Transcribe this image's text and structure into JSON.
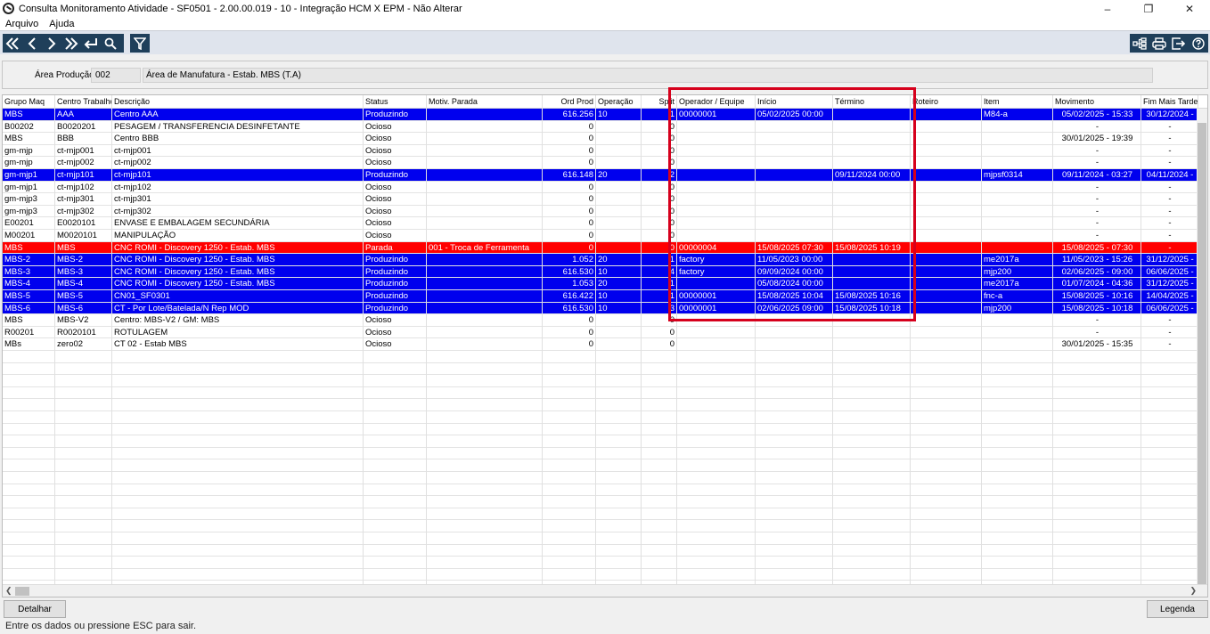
{
  "window": {
    "title": "Consulta Monitoramento Atividade - SF0501 - 2.00.00.019 - 10 - Integração HCM X EPM - Não Alterar",
    "minimize": "–",
    "maximize": "❐",
    "close": "✕"
  },
  "menu": [
    "Arquivo",
    "Ajuda"
  ],
  "header": {
    "area_label": "Área Produção:",
    "area_code": "002",
    "area_desc": "Área de Manufatura - Estab. MBS (T.A)"
  },
  "columns": [
    "Grupo Maq",
    "Centro Trabalho",
    "Descrição",
    "Status",
    "Motiv. Parada",
    "Ord Prod",
    "Operação",
    "Split",
    "Operador / Equipe",
    "Início",
    "Término",
    "Roteiro",
    "Item",
    "Movimento",
    "Fim Mais Tarde"
  ],
  "rows": [
    {
      "style": "blue",
      "c": [
        "MBS",
        "AAA",
        "Centro AAA",
        "Produzindo",
        "",
        "616.256",
        "10",
        "1",
        "00000001",
        "05/02/2025 00:00",
        "",
        "",
        "M84-a",
        "05/02/2025 - 15:33",
        "30/12/2024 -"
      ]
    },
    {
      "style": "",
      "c": [
        "B00202",
        "B0020201",
        "PESAGEM / TRANSFERENCIA DESINFETANTE",
        "Ocioso",
        "",
        "0",
        "",
        "0",
        "",
        "",
        "",
        "",
        "",
        "-",
        "-"
      ]
    },
    {
      "style": "",
      "c": [
        "MBS",
        "BBB",
        "Centro BBB",
        "Ocioso",
        "",
        "0",
        "",
        "0",
        "",
        "",
        "",
        "",
        "",
        "30/01/2025 - 19:39",
        "-"
      ]
    },
    {
      "style": "",
      "c": [
        "gm-mjp",
        "ct-mjp001",
        "ct-mjp001",
        "Ocioso",
        "",
        "0",
        "",
        "0",
        "",
        "",
        "",
        "",
        "",
        "-",
        "-"
      ]
    },
    {
      "style": "",
      "c": [
        "gm-mjp",
        "ct-mjp002",
        "ct-mjp002",
        "Ocioso",
        "",
        "0",
        "",
        "0",
        "",
        "",
        "",
        "",
        "",
        "-",
        "-"
      ]
    },
    {
      "style": "blue",
      "c": [
        "gm-mjp1",
        "ct-mjp101",
        "ct-mjp101",
        "Produzindo",
        "",
        "616.148",
        "20",
        "2",
        "",
        "",
        "09/11/2024 00:00",
        "",
        "mjpsf0314",
        "09/11/2024 - 03:27",
        "04/11/2024 -"
      ]
    },
    {
      "style": "",
      "c": [
        "gm-mjp1",
        "ct-mjp102",
        "ct-mjp102",
        "Ocioso",
        "",
        "0",
        "",
        "0",
        "",
        "",
        "",
        "",
        "",
        "-",
        "-"
      ]
    },
    {
      "style": "",
      "c": [
        "gm-mjp3",
        "ct-mjp301",
        "ct-mjp301",
        "Ocioso",
        "",
        "0",
        "",
        "0",
        "",
        "",
        "",
        "",
        "",
        "-",
        "-"
      ]
    },
    {
      "style": "",
      "c": [
        "gm-mjp3",
        "ct-mjp302",
        "ct-mjp302",
        "Ocioso",
        "",
        "0",
        "",
        "0",
        "",
        "",
        "",
        "",
        "",
        "-",
        "-"
      ]
    },
    {
      "style": "",
      "c": [
        "E00201",
        "E0020101",
        "ENVASE E EMBALAGEM SECUNDÁRIA",
        "Ocioso",
        "",
        "0",
        "",
        "0",
        "",
        "",
        "",
        "",
        "",
        "-",
        "-"
      ]
    },
    {
      "style": "",
      "c": [
        "M00201",
        "M0020101",
        "MANIPULAÇÃO",
        "Ocioso",
        "",
        "0",
        "",
        "0",
        "",
        "",
        "",
        "",
        "",
        "-",
        "-"
      ]
    },
    {
      "style": "red",
      "c": [
        "MBS",
        "MBS",
        "CNC ROMI - Discovery 1250 - Estab. MBS",
        "Parada",
        "001      - Troca de Ferramenta",
        "0",
        "",
        "0",
        "00000004",
        "15/08/2025 07:30",
        "15/08/2025 10:19",
        "",
        "",
        "15/08/2025 - 07:30",
        "-"
      ]
    },
    {
      "style": "blue",
      "c": [
        "MBS-2",
        "MBS-2",
        "CNC ROMI - Discovery 1250 - Estab. MBS",
        "Produzindo",
        "",
        "1.052",
        "20",
        "1",
        "factory",
        "11/05/2023 00:00",
        "",
        "",
        "me2017a",
        "11/05/2023 - 15:26",
        "31/12/2025 -"
      ]
    },
    {
      "style": "blue",
      "c": [
        "MBS-3",
        "MBS-3",
        "CNC ROMI - Discovery 1250 - Estab. MBS",
        "Produzindo",
        "",
        "616.530",
        "10",
        "4",
        "factory",
        "09/09/2024 00:00",
        "",
        "",
        "mjp200",
        "02/06/2025 - 09:00",
        "06/06/2025 -"
      ]
    },
    {
      "style": "blue",
      "c": [
        "MBS-4",
        "MBS-4",
        "CNC ROMI - Discovery 1250 - Estab. MBS",
        "Produzindo",
        "",
        "1.053",
        "20",
        "1",
        "",
        "05/08/2024 00:00",
        "",
        "",
        "me2017a",
        "01/07/2024 - 04:36",
        "31/12/2025 -"
      ]
    },
    {
      "style": "blue",
      "c": [
        "MBS-5",
        "MBS-5",
        "CN01_SF0301",
        "Produzindo",
        "",
        "616.422",
        "10",
        "1",
        "00000001",
        "15/08/2025 10:04",
        "15/08/2025 10:16",
        "",
        "fnc-a",
        "15/08/2025 - 10:16",
        "14/04/2025 -"
      ]
    },
    {
      "style": "blue",
      "c": [
        "MBS-6",
        "MBS-6",
        "CT - Por Lote/Batelada/N Rep MOD",
        "Produzindo",
        "",
        "616.530",
        "10",
        "3",
        "00000001",
        "02/06/2025 09:00",
        "15/08/2025 10:18",
        "",
        "mjp200",
        "15/08/2025 - 10:18",
        "06/06/2025 -"
      ]
    },
    {
      "style": "",
      "c": [
        "MBS",
        "MBS-V2",
        "Centro: MBS-V2 / GM: MBS",
        "Ocioso",
        "",
        "0",
        "",
        "0",
        "",
        "",
        "",
        "",
        "",
        "-",
        "-"
      ]
    },
    {
      "style": "",
      "c": [
        "R00201",
        "R0020101",
        "ROTULAGEM",
        "Ocioso",
        "",
        "0",
        "",
        "0",
        "",
        "",
        "",
        "",
        "",
        "-",
        "-"
      ]
    },
    {
      "style": "",
      "c": [
        "MBs",
        "zero02",
        "CT 02 - Estab MBS",
        "Ocioso",
        "",
        "0",
        "",
        "0",
        "",
        "",
        "",
        "",
        "",
        "30/01/2025 - 15:35",
        "-"
      ]
    }
  ],
  "buttons": {
    "detalhar": "Detalhar",
    "legenda": "Legenda"
  },
  "status_text": "Entre os dados ou pressione ESC para sair.",
  "colors": {
    "producing": "#0000ee",
    "stopped": "#ff0000",
    "highlight": "#d6001c",
    "toolbar_button": "#1f3f5a"
  }
}
